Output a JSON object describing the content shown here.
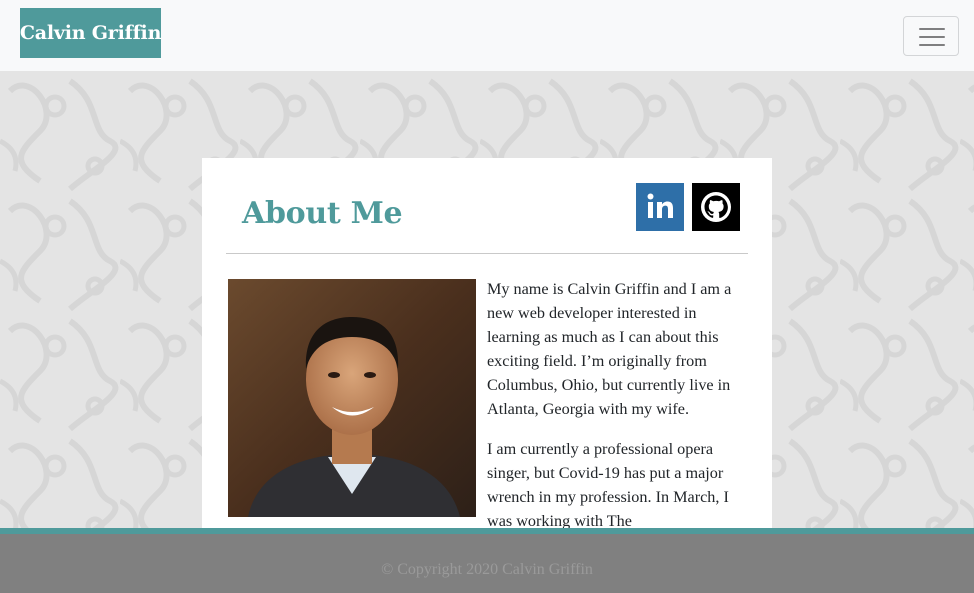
{
  "navbar": {
    "brand": "Calvin Griffin",
    "toggle_icon": "hamburger-menu-icon"
  },
  "about": {
    "title": "About Me",
    "social": [
      {
        "name": "LinkedIn",
        "icon": "linkedin-icon",
        "color": "#2e6fa8"
      },
      {
        "name": "GitHub",
        "icon": "github-icon",
        "color": "#000000"
      }
    ],
    "paragraphs": [
      "My name is Calvin Griffin and I am a new web developer interested in learning as much as I can about this exciting field. I’m originally from Columbus, Ohio, but currently live in Atlanta, Georgia with my wife.",
      "I am currently a professional opera singer, but Covid-19 has put a major wrench in my profession. In March, I was working with The"
    ]
  },
  "footer": {
    "copyright": "© Copyright 2020 Calvin Griffin"
  },
  "colors": {
    "accent": "#4f9a9b",
    "footer": "#808080",
    "linkedin": "#2e6fa8"
  }
}
